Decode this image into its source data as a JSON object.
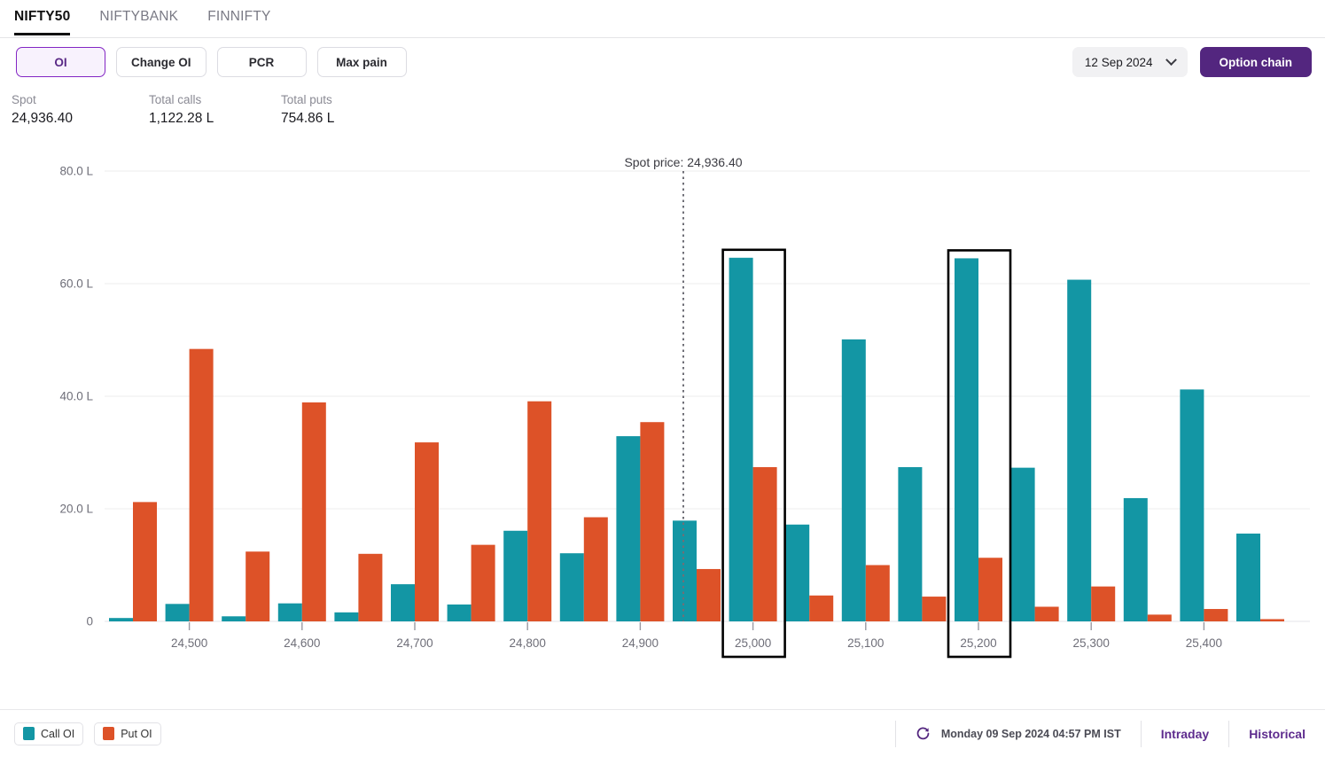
{
  "tabs": [
    {
      "label": "NIFTY50",
      "active": true
    },
    {
      "label": "NIFTYBANK",
      "active": false
    },
    {
      "label": "FINNIFTY",
      "active": false
    }
  ],
  "toolbar": {
    "buttons": [
      {
        "label": "OI",
        "selected": true
      },
      {
        "label": "Change OI",
        "selected": false
      },
      {
        "label": "PCR",
        "selected": false
      },
      {
        "label": "Max pain",
        "selected": false
      }
    ],
    "date_value": "12 Sep 2024",
    "chevron_icon": "chevron-down-icon",
    "option_chain_label": "Option chain"
  },
  "stats": [
    {
      "label": "Spot",
      "value": "24,936.40"
    },
    {
      "label": "Total calls",
      "value": "1,122.28 L"
    },
    {
      "label": "Total puts",
      "value": "754.86 L"
    }
  ],
  "footer": {
    "legend": [
      {
        "label": "Call OI",
        "color": "#1396a4"
      },
      {
        "label": "Put OI",
        "color": "#dd5228"
      }
    ],
    "refresh_icon": "refresh-icon",
    "timestamp": "Monday 09 Sep 2024 04:57 PM IST",
    "links": [
      {
        "label": "Intraday"
      },
      {
        "label": "Historical"
      }
    ]
  },
  "chart_data": {
    "type": "bar",
    "title": "",
    "xlabel": "",
    "ylabel": "",
    "ylim": [
      0,
      85
    ],
    "ytick_labels": [
      "0",
      "20.0 L",
      "40.0 L",
      "60.0 L",
      "80.0 L"
    ],
    "ytick_values": [
      0,
      20,
      40,
      60,
      80
    ],
    "grid": true,
    "legend_position": "bottom-left",
    "xtick_labels": [
      "24,500",
      "24,600",
      "24,700",
      "24,800",
      "24,900",
      "25,000",
      "25,100",
      "25,200",
      "25,300",
      "25,400"
    ],
    "xtick_values": [
      24500,
      24600,
      24700,
      24800,
      24900,
      25000,
      25100,
      25200,
      25300,
      25400
    ],
    "categories": [
      24450,
      24500,
      24550,
      24600,
      24650,
      24700,
      24750,
      24800,
      24850,
      24900,
      24950,
      25000,
      25050,
      25100,
      25150,
      25200,
      25250,
      25300,
      25350,
      25400,
      25450
    ],
    "series": [
      {
        "name": "Call OI",
        "color": "#1396a4",
        "values": [
          0.6,
          3.1,
          0.9,
          3.2,
          1.6,
          6.6,
          3.0,
          16.1,
          12.1,
          32.9,
          17.9,
          64.6,
          17.2,
          50.1,
          27.4,
          64.5,
          27.3,
          60.7,
          21.9,
          41.2,
          15.6
        ]
      },
      {
        "name": "Put OI",
        "color": "#dd5228",
        "values": [
          21.2,
          48.4,
          12.4,
          38.9,
          12.0,
          31.8,
          13.6,
          39.1,
          18.5,
          35.4,
          9.3,
          27.4,
          4.6,
          10.0,
          4.4,
          11.3,
          2.6,
          6.2,
          1.2,
          2.2,
          0.4
        ]
      }
    ],
    "annotations": [
      {
        "kind": "vline",
        "label": "Spot price: 24,936.40",
        "value": 24936.4
      }
    ],
    "highlighted_categories": [
      25000,
      25200
    ]
  }
}
